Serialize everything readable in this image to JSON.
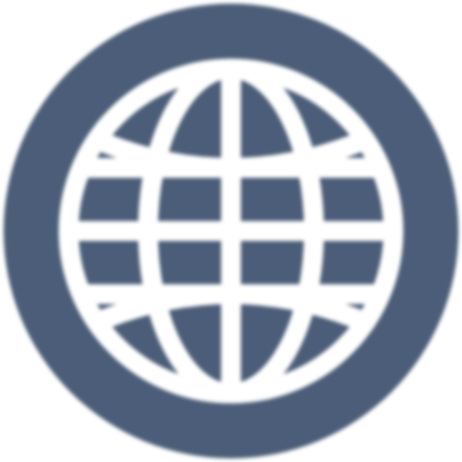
{
  "icon": {
    "name": "globe-icon",
    "badge_color": "#4b5d78",
    "stroke_color": "#ffffff"
  }
}
